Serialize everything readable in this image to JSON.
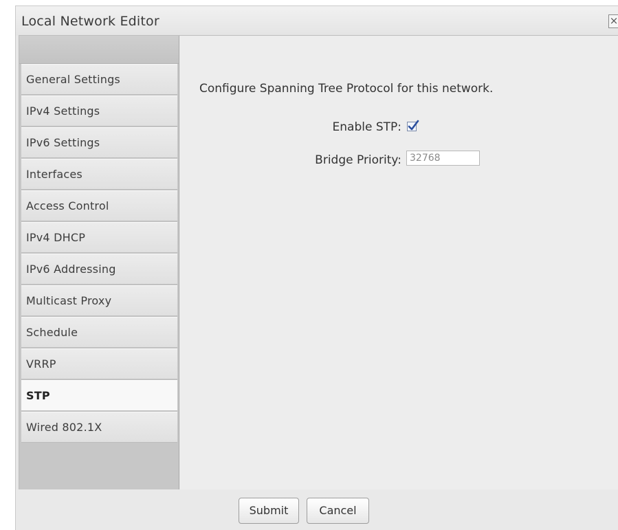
{
  "window": {
    "title": "Local Network Editor",
    "close_glyph": "×"
  },
  "sidebar": {
    "items": [
      {
        "label": "General Settings",
        "active": false
      },
      {
        "label": "IPv4 Settings",
        "active": false
      },
      {
        "label": "IPv6 Settings",
        "active": false
      },
      {
        "label": "Interfaces",
        "active": false
      },
      {
        "label": "Access Control",
        "active": false
      },
      {
        "label": "IPv4 DHCP",
        "active": false
      },
      {
        "label": "IPv6 Addressing",
        "active": false
      },
      {
        "label": "Multicast Proxy",
        "active": false
      },
      {
        "label": "Schedule",
        "active": false
      },
      {
        "label": "VRRP",
        "active": false
      },
      {
        "label": "STP",
        "active": true
      },
      {
        "label": "Wired 802.1X",
        "active": false
      }
    ]
  },
  "stp": {
    "description": "Configure Spanning Tree Protocol for this network.",
    "enable_label": "Enable STP:",
    "enable_checked": true,
    "priority_label": "Bridge Priority:",
    "priority_value": "32768"
  },
  "footer": {
    "submit_label": "Submit",
    "cancel_label": "Cancel"
  },
  "colors": {
    "checkmark": "#2b4f9e"
  }
}
